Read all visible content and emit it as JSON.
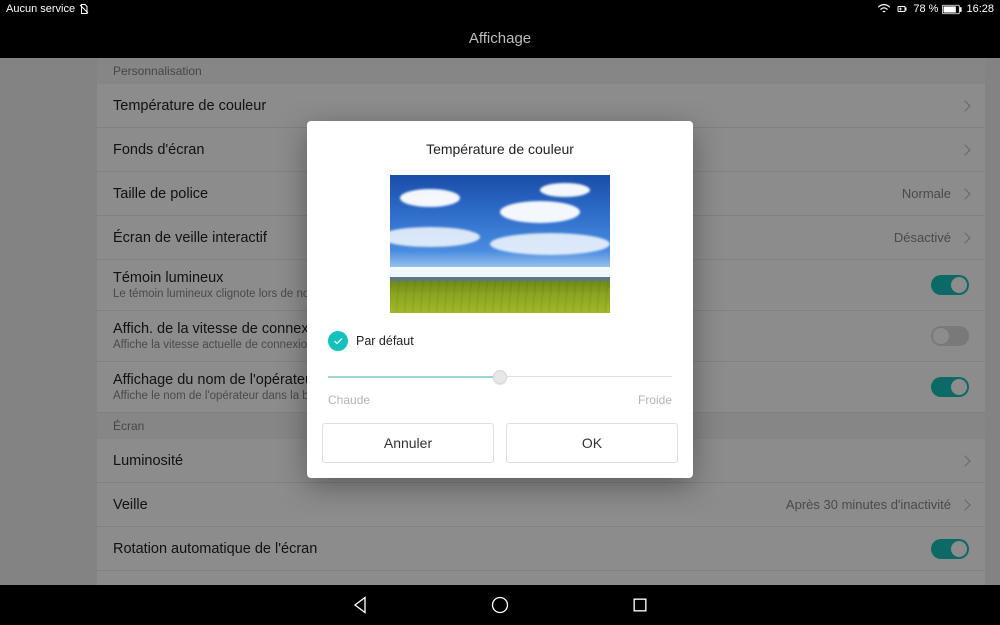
{
  "statusbar": {
    "service_text": "Aucun service",
    "battery_percent": "78 %",
    "time": "16:28"
  },
  "header": {
    "title": "Affichage"
  },
  "sections": {
    "personalization": "Personnalisation",
    "screen": "Écran"
  },
  "rows": {
    "color_temp": "Température de couleur",
    "wallpaper": "Fonds d'écran",
    "font_size": {
      "label": "Taille de police",
      "value": "Normale"
    },
    "daydream": {
      "label": "Écran de veille interactif",
      "value": "Désactivé"
    },
    "notif_light": {
      "label": "Témoin lumineux",
      "sub": "Le témoin lumineux clignote lors de nouveaux messages"
    },
    "net_speed": {
      "label": "Affich. de la vitesse de connexion",
      "sub": "Affiche la vitesse actuelle de connexion au réseau"
    },
    "carrier": {
      "label": "Affichage du nom de l'opérateur",
      "sub": "Affiche le nom de l'opérateur dans la barre d'état"
    },
    "brightness": "Luminosité",
    "sleep": {
      "label": "Veille",
      "value": "Après 30 minutes d'inactivité"
    },
    "rotate": "Rotation automatique de l'écran"
  },
  "dialog": {
    "title": "Température de couleur",
    "default_label": "Par défaut",
    "warm_label": "Chaude",
    "cold_label": "Froide",
    "cancel": "Annuler",
    "ok": "OK"
  }
}
